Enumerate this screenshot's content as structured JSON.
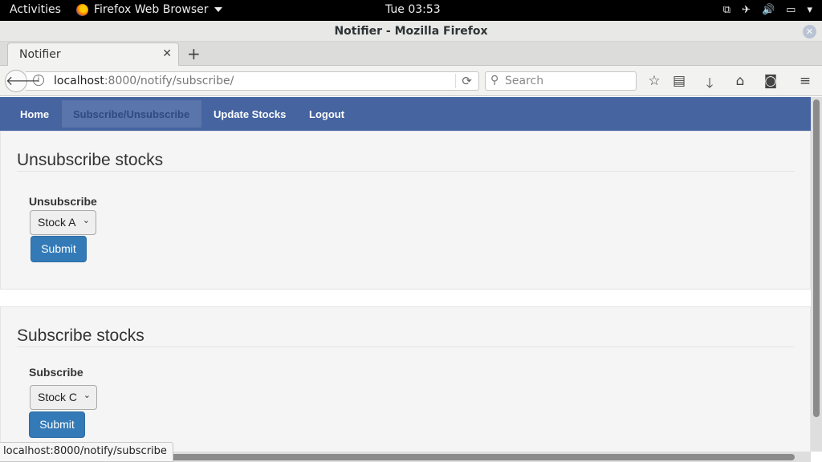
{
  "system": {
    "activities": "Activities",
    "app_menu": "Firefox Web Browser",
    "clock": "Tue 03:53",
    "tray_icons": [
      "network-icon",
      "airplane-icon",
      "volume-icon",
      "battery-icon",
      "power-menu-icon"
    ]
  },
  "window": {
    "title": "Notifier - Mozilla Firefox"
  },
  "browser": {
    "tab_title": "Notifier",
    "url_host": "localhost",
    "url_path": ":8000/notify/subscribe/",
    "search_placeholder": "Search",
    "status_text": "localhost:8000/notify/subscribe"
  },
  "nav": {
    "items": [
      {
        "label": "Home"
      },
      {
        "label": "Subscribe/Unsubscribe",
        "active": true
      },
      {
        "label": "Update Stocks"
      },
      {
        "label": "Logout"
      }
    ]
  },
  "unsubscribe": {
    "heading": "Unsubscribe stocks",
    "label": "Unsubscribe",
    "selected": "Stock A",
    "submit": "Submit"
  },
  "subscribe": {
    "heading": "Subscribe stocks",
    "label": "Subscribe",
    "selected": "Stock C",
    "submit": "Submit"
  },
  "colors": {
    "navbar": "#4564a0",
    "button": "#337ab7",
    "panel": "#f5f5f5"
  }
}
